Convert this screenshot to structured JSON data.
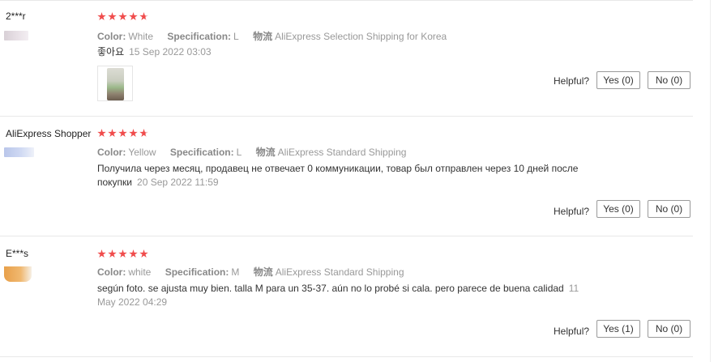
{
  "reviews": [
    {
      "user": "2***r",
      "color_label": "Color:",
      "color_value": "White",
      "spec_label": "Specification:",
      "spec_value": "L",
      "ship_label": "物流",
      "ship_value": "AliExpress Selection Shipping for Korea",
      "text": "좋아요",
      "date": "15 Sep 2022 03:03",
      "helpful_label": "Helpful?",
      "yes_label": "Yes (0)",
      "no_label": "No (0)",
      "rating_stars": 5
    },
    {
      "user": "AliExpress Shopper",
      "color_label": "Color:",
      "color_value": "Yellow",
      "spec_label": "Specification:",
      "spec_value": "L",
      "ship_label": "物流",
      "ship_value": "AliExpress Standard Shipping",
      "text": "Получила через месяц, продавец не отвечает 0 коммуникации, товар был отправлен через 10 дней после покупки",
      "date": "20 Sep 2022 11:59",
      "helpful_label": "Helpful?",
      "yes_label": "Yes (0)",
      "no_label": "No (0)",
      "rating_stars": 5
    },
    {
      "user": "E***s",
      "color_label": "Color:",
      "color_value": "white",
      "spec_label": "Specification:",
      "spec_value": "M",
      "ship_label": "物流",
      "ship_value": "AliExpress Standard Shipping",
      "text": "según foto. se ajusta muy bien. talla M para un 35-37. aún no lo probé si cala. pero parece de buena calidad",
      "date": "11 May 2022 04:29",
      "helpful_label": "Helpful?",
      "yes_label": "Yes (1)",
      "no_label": "No (0)",
      "rating_stars": 5
    }
  ],
  "colors": {
    "star": "#f04c4c",
    "divider": "#e8e8e8",
    "meta_text": "#999999"
  }
}
